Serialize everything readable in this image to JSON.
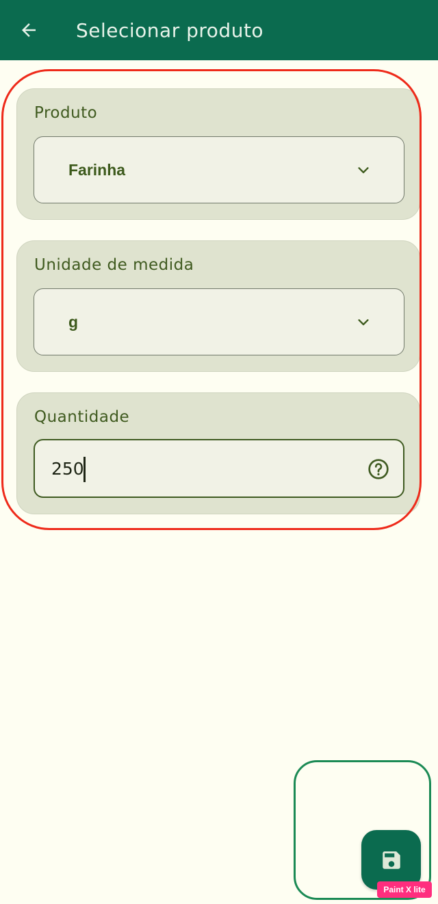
{
  "appbar": {
    "title": "Selecionar produto",
    "back_icon": "arrow-left-icon",
    "background": "#0b6b4f"
  },
  "form": {
    "product": {
      "label": "Produto",
      "value": "Farinha"
    },
    "unit": {
      "label": "Unidade de medida",
      "value": "g"
    },
    "quantity": {
      "label": "Quantidade",
      "value": "250",
      "help_icon": "help-circle-icon"
    }
  },
  "fab": {
    "icon": "save-icon"
  },
  "watermark": {
    "text": "Paint X lite"
  },
  "annotations": {
    "red_outline_color": "#ee2a1a",
    "green_outline_color": "#1b8a55"
  }
}
